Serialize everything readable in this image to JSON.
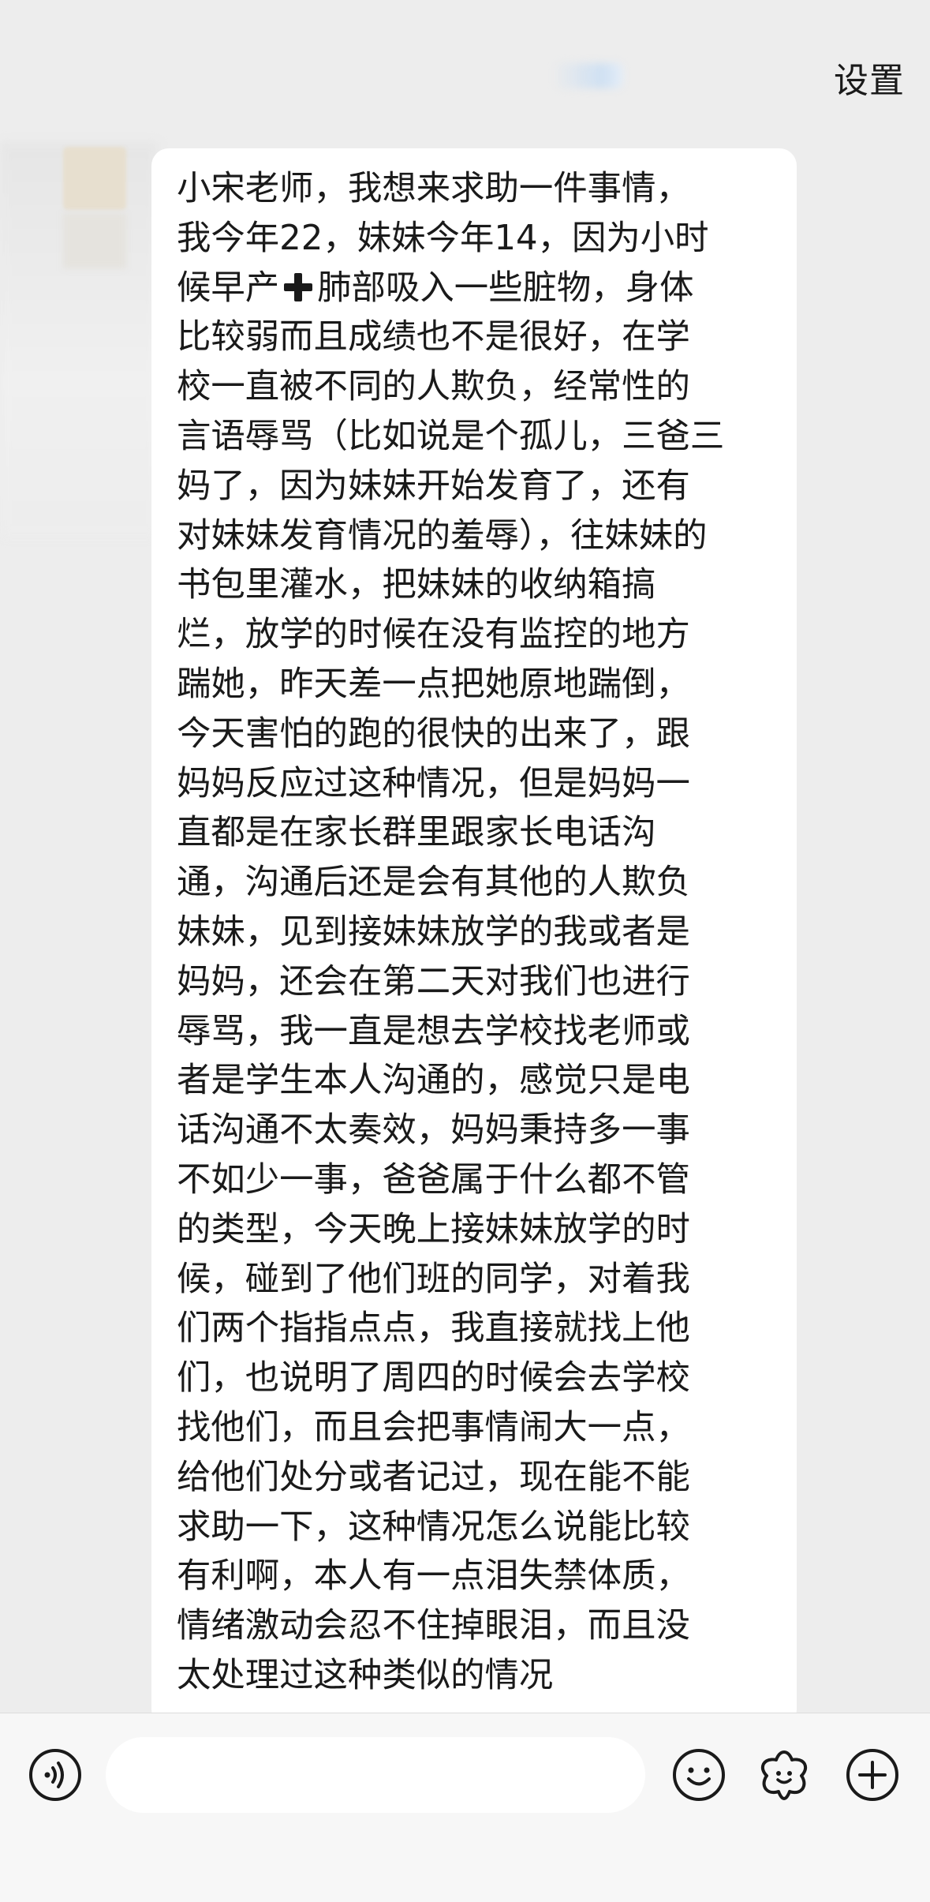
{
  "header": {
    "settings_label": "设置"
  },
  "message": {
    "line1": "小宋老师，我想来求助一件事情，",
    "line2": "我今年22，妹妹今年14，因为小时",
    "line3_pre": "候早产",
    "line3_post": "肺部吸入一些脏物，身体",
    "body": "比较弱而且成绩也不是很好，在学\n校一直被不同的人欺负，经常性的\n言语辱骂（比如说是个孤儿，三爸三\n妈了，因为妹妹开始发育了，还有\n对妹妹发育情况的羞辱），往妹妹的\n书包里灌水，把妹妹的收纳箱搞\n烂，放学的时候在没有监控的地方\n踹她，昨天差一点把她原地踹倒，\n今天害怕的跑的很快的出来了，跟\n妈妈反应过这种情况，但是妈妈一\n直都是在家长群里跟家长电话沟\n通，沟通后还是会有其他的人欺负\n妹妹，见到接妹妹放学的我或者是\n妈妈，还会在第二天对我们也进行\n辱骂，我一直是想去学校找老师或\n者是学生本人沟通的，感觉只是电\n话沟通不太奏效，妈妈秉持多一事\n不如少一事，爸爸属于什么都不管\n的类型，今天晚上接妹妹放学的时\n候，碰到了他们班的同学，对着我\n们两个指指点点，我直接就找上他\n们，也说明了周四的时候会去学校\n找他们，而且会把事情闹大一点，\n给他们处分或者记过，现在能不能\n求助一下，这种情况怎么说能比较\n有利啊，本人有一点泪失禁体质，\n情绪激动会忍不住掉眼泪，而且没\n太处理过这种类似的情况",
    "cross_icon": "heavy-plus-sign-emoji"
  },
  "input_bar": {
    "voice_icon": "voice-input-icon",
    "emoji_icon": "emoji-face-icon",
    "sticker_icon": "sticker-flower-icon",
    "more_icon": "plus-circle-icon",
    "input_value": ""
  }
}
